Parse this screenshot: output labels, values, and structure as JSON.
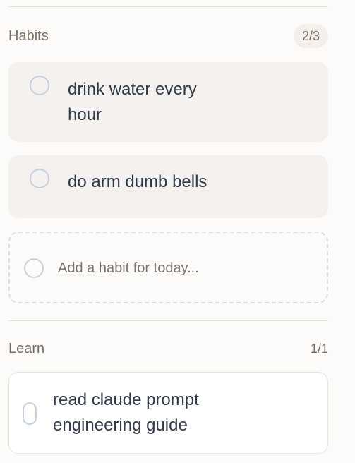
{
  "sections": {
    "habits": {
      "title": "Habits",
      "count": "2/3",
      "items": [
        {
          "label": "drink water every\nhour"
        },
        {
          "label": "do arm dumb bells"
        }
      ],
      "add_placeholder": "Add a habit for today..."
    },
    "learn": {
      "title": "Learn",
      "count": "1/1",
      "items": [
        {
          "label": "read claude prompt\nengineering guide"
        }
      ]
    }
  },
  "icons": {
    "unchecked": "circle-outline-icon",
    "pill": "pill-checkbox-icon"
  },
  "colors": {
    "background": "#fdfbf9",
    "card": "#f4f1ee",
    "text": "#2f3a4b",
    "muted": "#776f66",
    "border": "#d8dde7"
  }
}
